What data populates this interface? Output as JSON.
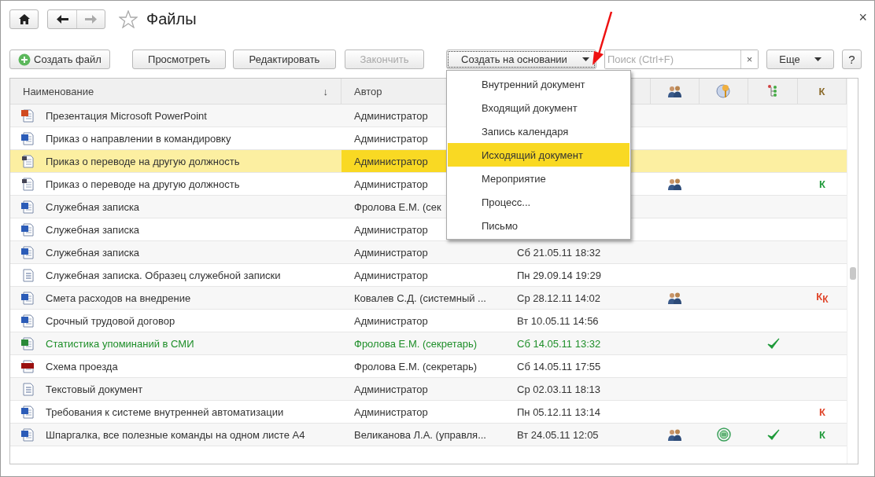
{
  "window": {
    "title": "Файлы",
    "close": "×"
  },
  "toolbar": [
    {
      "kind": "create",
      "label": "Создать файл",
      "disabled": false
    },
    {
      "kind": "plain",
      "label": "Просмотреть",
      "disabled": false
    },
    {
      "kind": "plain",
      "label": "Редактировать",
      "disabled": false
    },
    {
      "kind": "plain",
      "label": "Закончить",
      "disabled": true
    },
    {
      "kind": "menu",
      "label": "Создать на основании",
      "disabled": false
    }
  ],
  "search": {
    "placeholder": "Поиск (Ctrl+F)",
    "clear": "×"
  },
  "more_button": {
    "label": "Еще"
  },
  "help_button": {
    "label": "?"
  },
  "table": {
    "columns": [
      {
        "kind": "text",
        "label": "Наименование",
        "sort_mark": "↓"
      },
      {
        "kind": "text",
        "label": "Автор"
      },
      {
        "kind": "blank"
      },
      {
        "kind": "people"
      },
      {
        "kind": "seal"
      },
      {
        "kind": "tree"
      },
      {
        "kind": "text",
        "label": "К",
        "color": "#8a6a2a"
      }
    ],
    "rows": [
      {
        "kind": "ppt",
        "name": "Презентация Microsoft PowerPoint",
        "author": "Администратор",
        "selected": false,
        "shared": false,
        "signed": false,
        "done": false
      },
      {
        "kind": "word",
        "name": "Приказ о направлении в командировку",
        "author": "Администратор",
        "selected": false,
        "shared": false,
        "signed": false,
        "done": false
      },
      {
        "kind": "template",
        "name": "Приказ о переводе на другую должность",
        "author": "Администратор",
        "selected": true,
        "shared": false,
        "signed": false,
        "done": false
      },
      {
        "kind": "template",
        "name": "Приказ о переводе на другую должность",
        "author": "Администратор",
        "selected": false,
        "shared": true,
        "signed": false,
        "done": false,
        "mark": {
          "text": "К",
          "color": "#1f9a3a"
        }
      },
      {
        "kind": "word",
        "name": "Служебная записка",
        "author": "Фролова Е.М. (сек",
        "selected": false,
        "shared": false,
        "signed": false,
        "done": false
      },
      {
        "kind": "word",
        "name": "Служебная записка",
        "author": "Администратор",
        "selected": false,
        "shared": false,
        "signed": false,
        "done": false
      },
      {
        "kind": "word",
        "name": "Служебная записка",
        "author": "Администратор",
        "date": "Сб 21.05.11 18:32",
        "selected": false,
        "shared": false,
        "signed": false,
        "done": false
      },
      {
        "kind": "text",
        "name": "Служебная записка. Образец служебной записки",
        "author": "Администратор",
        "date": "Пн 29.09.14 19:29",
        "selected": false,
        "shared": false,
        "signed": false,
        "done": false
      },
      {
        "kind": "word",
        "name": "Смета расходов на внедрение",
        "author": "Ковалев С.Д. (системный ...",
        "date": "Ср 28.12.11 14:02",
        "selected": false,
        "shared": true,
        "signed": false,
        "done": false,
        "mark": {
          "text": "К$_{К}$",
          "color": "#e0452a"
        }
      },
      {
        "kind": "word",
        "name": "Срочный трудовой договор",
        "author": "Администратор",
        "date": "Вт 10.05.11 14:56",
        "selected": false,
        "shared": false,
        "signed": false,
        "done": false
      },
      {
        "kind": "excel",
        "name": "Статистика упоминаний в СМИ",
        "author": "Фролова Е.М. (секретарь)",
        "date": "Сб 14.05.11 13:32",
        "color": "#1f8f2a",
        "selected": false,
        "shared": false,
        "signed": false,
        "done": true
      },
      {
        "kind": "png",
        "name": "Схема проезда",
        "author": "Фролова Е.М. (секретарь)",
        "date": "Сб 14.05.11 17:55",
        "selected": false,
        "shared": false,
        "signed": false,
        "done": false
      },
      {
        "kind": "text",
        "name": "Текстовый документ",
        "author": "Администратор",
        "date": "Ср 02.03.11 18:13",
        "selected": false,
        "shared": false,
        "signed": false,
        "done": false
      },
      {
        "kind": "word",
        "name": "Требования к системе внутренней автоматизации",
        "author": "Администратор",
        "date": "Пн 05.12.11 13:14",
        "selected": false,
        "shared": false,
        "signed": false,
        "done": false,
        "mark": {
          "text": "К",
          "color": "#e0452a"
        }
      },
      {
        "kind": "word",
        "name": "Шпаргалка, все полезные команды на одном листе А4",
        "author": "Великанова Л.А. (управля...",
        "date": "Вт 24.05.11 12:05",
        "selected": false,
        "shared": true,
        "signed": true,
        "done": true,
        "mark": {
          "text": "К",
          "color": "#1f9a3a"
        }
      }
    ]
  },
  "dropdown": {
    "items": [
      {
        "label": "Внутренний документ",
        "selected": false
      },
      {
        "label": "Входящий документ",
        "selected": false
      },
      {
        "label": "Запись календаря",
        "selected": false
      },
      {
        "label": "Исходящий документ",
        "selected": true
      },
      {
        "label": "Мероприятие",
        "selected": false
      },
      {
        "label": "Процесс...",
        "selected": false
      },
      {
        "label": "Письмо",
        "selected": false
      }
    ]
  }
}
